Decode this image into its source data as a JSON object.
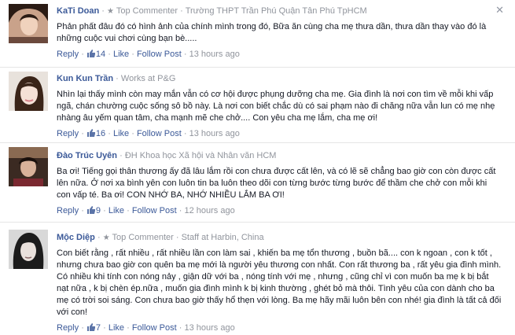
{
  "close_label": "✕",
  "comments": [
    {
      "name": "KaTi Doan",
      "badge": "Top Commenter",
      "affiliation": "Trường THPT Trần Phú Quận Tân Phú TpHCM",
      "text": "Phản phất đâu đó có hình ảnh của chính mình trong đó, Bữa ăn cùng cha mẹ thưa dần, thưa dần thay vào đó là những cuộc vui chơi cùng bạn bè.....",
      "reply": "Reply",
      "likes": "14",
      "like": "Like",
      "follow": "Follow Post",
      "time": "13 hours ago"
    },
    {
      "name": "Kun Kun Trần",
      "affiliation": "Works at P&G",
      "text": "Nhìn lại thấy mình còn may mắn vẫn có cơ hội được phụng dưỡng cha mẹ. Gia đình là nơi con tìm về mỗi khi vấp ngã, chán chường cuộc sống sô bồ này. Là nơi con biết chắc dù có sai phạm nào đi chăng nữa vẫn lun có mẹ nhẹ nhàng âu yếm quan tâm, cha mạnh mẽ che chở.... Con yêu cha mẹ lắm, cha mẹ ơi!",
      "reply": "Reply",
      "likes": "16",
      "like": "Like",
      "follow": "Follow Post",
      "time": "13 hours ago"
    },
    {
      "name": "Đào Trúc Uyên",
      "affiliation": "ĐH Khoa học Xã hội và Nhân văn HCM",
      "text": "Ba ơi! Tiếng gọi thân thương ấy đã lâu lắm rồi con chưa được cất lên, và có lẽ sẽ chẳng bao giờ con còn được cất lên nữa. Ở nơi xa bình yên con luôn tin ba luôn theo dõi con từng bước từng bước để thầm che chở con mỗi khi con vấp té. Ba ơi! CON NHỚ BA, NHỚ NHIỀU LẮM BA ƠI!",
      "reply": "Reply",
      "likes": "9",
      "like": "Like",
      "follow": "Follow Post",
      "time": "12 hours ago"
    },
    {
      "name": "Mộc Diệp",
      "badge": "Top Commenter",
      "affiliation": "Staff at Harbin, China",
      "text": "Con biết rằng , rất nhiều , rất nhiều lần con làm sai , khiến ba mẹ tổn thương , buồn bã.... con k ngoan , con k tốt , nhưng chưa bao giờ con quên ba mẹ mới là người yêu thương con nhất. Con rất thương ba , rất yêu gia đình mình. Có nhiều khi tính con nóng nảy , giận dữ với ba , nóng tính với mẹ , nhưng , cũng chỉ vì con muốn ba mẹ k bị bắt nạt nữa , k bị chèn ép.nữa , muốn gia đình mình k bị kinh thường , ghét bỏ mà thôi. Tình yêu của con dành cho ba mẹ có trời soi sáng. Con chưa bao giờ thấy hổ thẹn với lòng. Ba mẹ hãy mãi luôn bên con nhé! gia đình là tất cả đối với con!",
      "reply": "Reply",
      "likes": "7",
      "like": "Like",
      "follow": "Follow Post",
      "time": "13 hours ago"
    }
  ]
}
